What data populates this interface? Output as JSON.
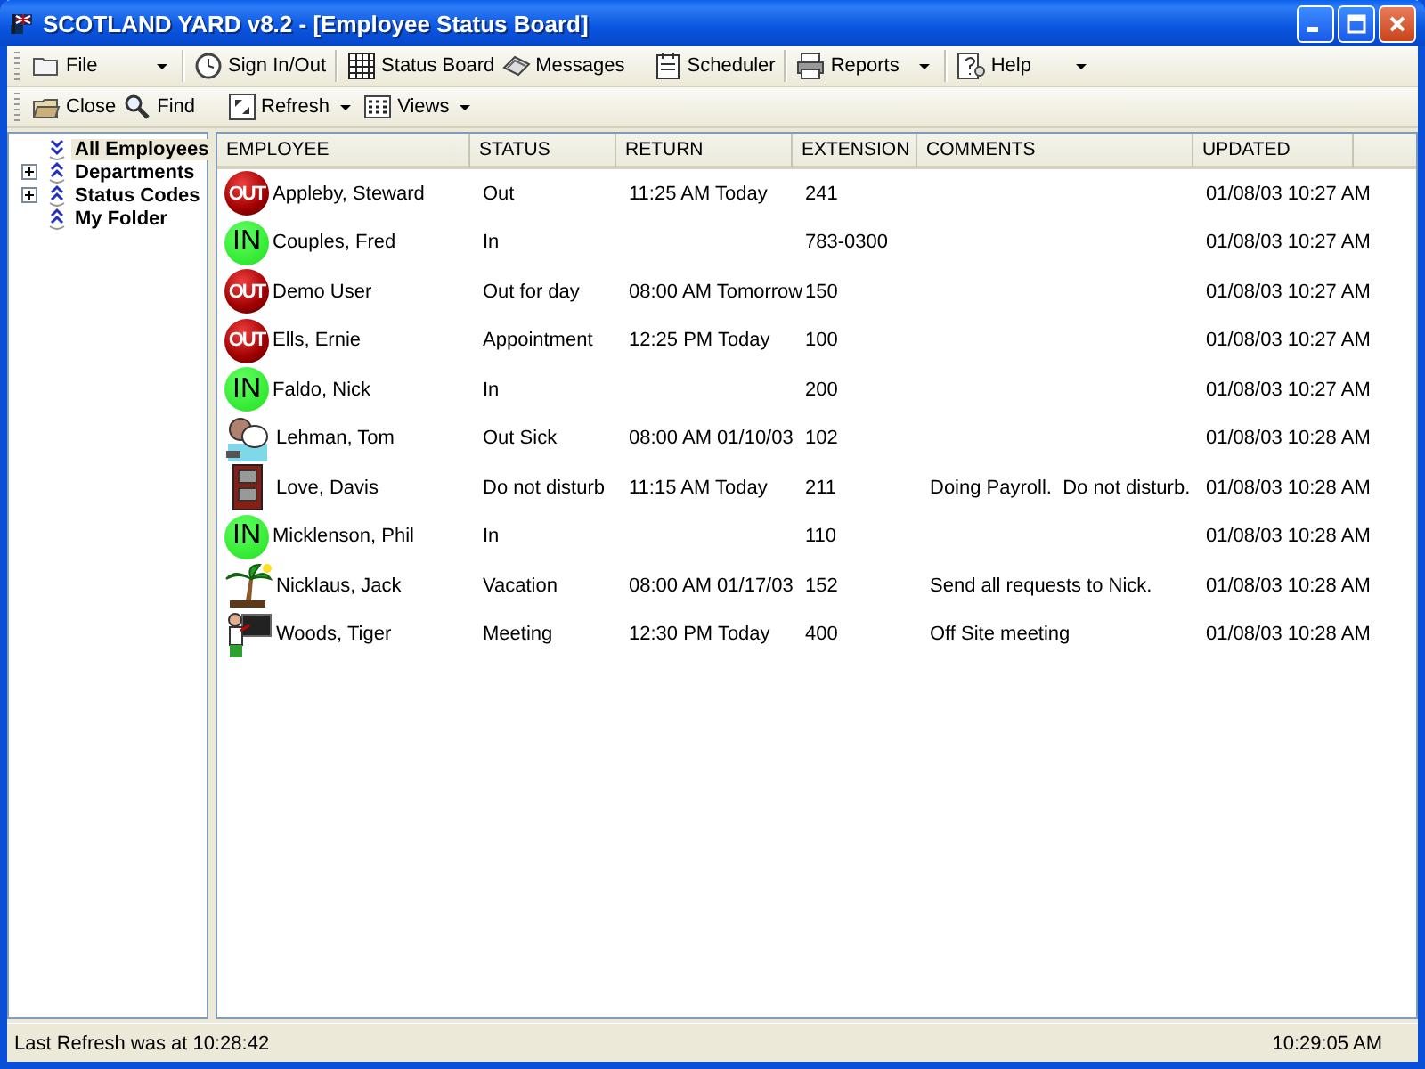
{
  "window": {
    "title": "SCOTLAND YARD v8.2 - [Employee Status Board]"
  },
  "toolbar_main": [
    {
      "label": "File",
      "dropdown": true
    },
    {
      "label": "Sign In/Out",
      "dropdown": false
    },
    {
      "label": "Status Board",
      "dropdown": false
    },
    {
      "label": "Messages",
      "dropdown": false
    },
    {
      "label": "Scheduler",
      "dropdown": false
    },
    {
      "label": "Reports",
      "dropdown": true
    },
    {
      "label": "Help",
      "dropdown": true
    }
  ],
  "toolbar_view": [
    {
      "label": "Close",
      "dropdown": false
    },
    {
      "label": "Find",
      "dropdown": false
    },
    {
      "label": "Refresh",
      "dropdown": true
    },
    {
      "label": "Views",
      "dropdown": true
    }
  ],
  "sidebar": {
    "items": [
      {
        "label": "All Employees",
        "selected": true
      },
      {
        "label": "Departments",
        "selected": false,
        "expanded": false
      },
      {
        "label": "Status Codes",
        "selected": false,
        "expanded": false
      },
      {
        "label": "My Folder",
        "selected": false
      }
    ]
  },
  "table": {
    "columns": [
      "EMPLOYEE",
      "STATUS",
      "RETURN",
      "EXTENSION",
      "COMMENTS",
      "UPDATED"
    ],
    "rows": [
      {
        "kind": "out",
        "badge": "OUT",
        "employee": "Appleby, Steward",
        "status": "Out",
        "return": "11:25 AM Today",
        "extension": "241",
        "updated": "01/08/03 10:27 AM"
      },
      {
        "kind": "in",
        "badge": "IN",
        "employee": "Couples, Fred",
        "status": "In",
        "extension": "783-0300",
        "updated": "01/08/03 10:27 AM"
      },
      {
        "kind": "out",
        "badge": "OUT",
        "employee": "Demo User",
        "status": "Out for day",
        "return": "08:00 AM Tomorrow",
        "extension": "150",
        "updated": "01/08/03 10:27 AM"
      },
      {
        "kind": "out",
        "badge": "OUT",
        "employee": "Ells, Ernie",
        "status": "Appointment",
        "return": "12:25 PM Today",
        "extension": "100",
        "updated": "01/08/03 10:27 AM"
      },
      {
        "kind": "in",
        "badge": "IN",
        "employee": "Faldo, Nick",
        "status": "In",
        "extension": "200",
        "updated": "01/08/03 10:27 AM"
      },
      {
        "kind": "sick",
        "employee": "Lehman, Tom",
        "status": "Out Sick",
        "return": "08:00 AM 01/10/03",
        "extension": "102",
        "updated": "01/08/03 10:28 AM"
      },
      {
        "kind": "dnd",
        "employee": "Love, Davis",
        "status": "Do not disturb",
        "return": "11:15 AM Today",
        "extension": "211",
        "comments": "Doing Payroll.  Do not disturb.",
        "updated": "01/08/03 10:28 AM"
      },
      {
        "kind": "in",
        "badge": "IN",
        "employee": "Micklenson, Phil",
        "status": "In",
        "extension": "110",
        "updated": "01/08/03 10:28 AM"
      },
      {
        "kind": "vacation",
        "employee": "Nicklaus, Jack",
        "status": "Vacation",
        "return": "08:00 AM 01/17/03",
        "extension": "152",
        "comments": "Send all requests to Nick.",
        "updated": "01/08/03 10:28 AM"
      },
      {
        "kind": "meeting",
        "employee": "Woods, Tiger",
        "status": "Meeting",
        "return": "12:30 PM Today",
        "extension": "400",
        "comments": "Off Site meeting",
        "updated": "01/08/03 10:28 AM"
      }
    ]
  },
  "status_bar": {
    "message": "Last Refresh was at 10:28:42",
    "clock": "10:29:05 AM"
  }
}
